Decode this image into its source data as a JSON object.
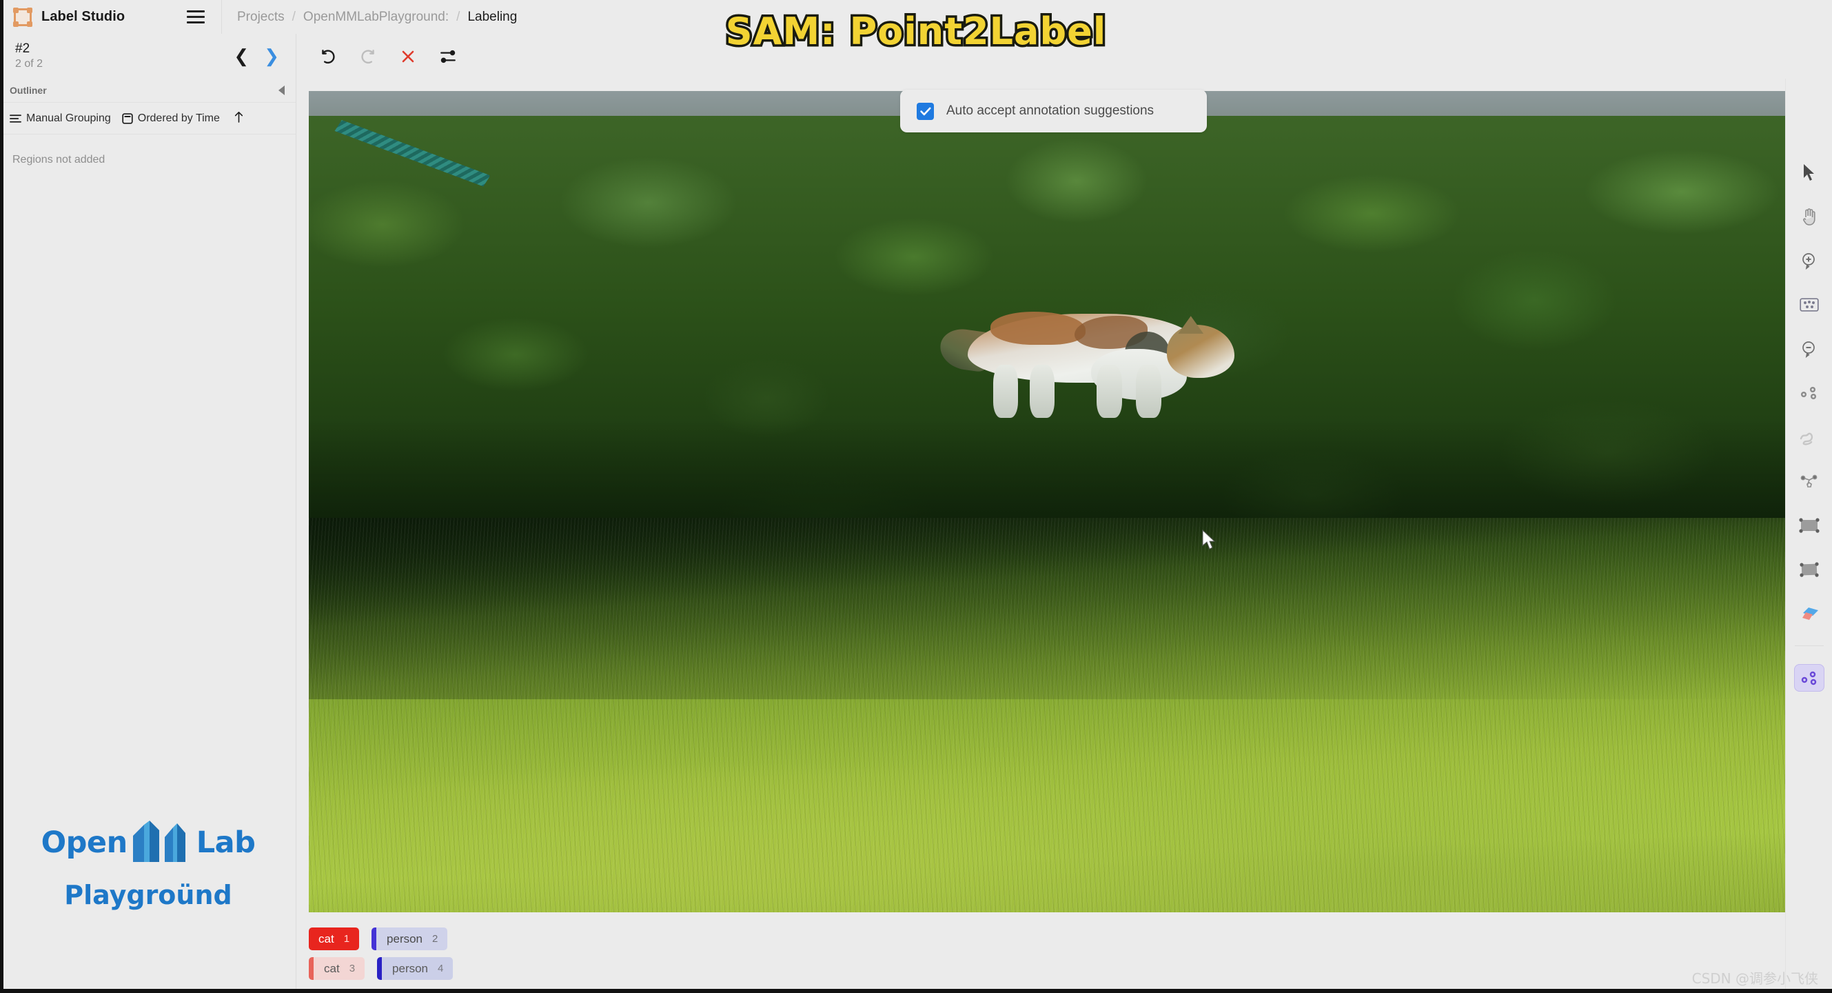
{
  "app": {
    "brand_name": "Label Studio",
    "logo_icon": "label-studio-frame-icon",
    "menu_icon": "hamburger-menu-icon"
  },
  "banner": {
    "title": "SAM: Point2Label"
  },
  "breadcrumb": {
    "items": [
      {
        "label": "Projects",
        "current": false
      },
      {
        "label": "OpenMMLabPlayground:",
        "current": false
      },
      {
        "label": "Labeling",
        "current": true
      }
    ],
    "separator": "/"
  },
  "task": {
    "id": "#2",
    "position": "2 of 2",
    "prev_icon": "chevron-left-icon",
    "next_icon": "chevron-right-icon"
  },
  "toolbar": {
    "buttons": [
      {
        "name": "undo-button",
        "icon": "undo-icon",
        "label": "Undo",
        "enabled": true
      },
      {
        "name": "redo-button",
        "icon": "redo-icon",
        "label": "Redo",
        "enabled": false
      },
      {
        "name": "delete-button",
        "icon": "close-x-icon",
        "label": "Delete all regions",
        "enabled": true
      },
      {
        "name": "settings-button",
        "icon": "sliders-icon",
        "label": "Settings",
        "enabled": true
      }
    ]
  },
  "outliner": {
    "title": "Outliner",
    "collapse_icon": "collapse-left-icon",
    "grouping_label": "Manual Grouping",
    "grouping_icon": "grouping-lines-icon",
    "ordering_label": "Ordered by Time",
    "ordering_icon": "ordering-box-icon",
    "sort_icon": "arrow-up-icon",
    "empty_message": "Regions not added"
  },
  "sidebar_logo": {
    "brand": "OpenMMLab",
    "brand_prefix": "Open",
    "brand_suffix": "Lab",
    "sub": "Playgroünd",
    "color": "#1e78c8"
  },
  "auto_accept": {
    "label": "Auto accept annotation suggestions",
    "checked": true,
    "check_icon": "checkmark-icon",
    "accent": "#1f7ae0"
  },
  "canvas": {
    "image_alt": "Calico cat walking on grass in front of a green hedge",
    "cursor_icon": "mouse-pointer-icon"
  },
  "tools_panel": {
    "items": [
      {
        "name": "cursor-tool",
        "icon": "mouse-pointer-icon",
        "label": "Move",
        "active": false
      },
      {
        "name": "pan-tool",
        "icon": "hand-icon",
        "label": "Pan",
        "active": false
      },
      {
        "name": "zoom-in-tool",
        "icon": "zoom-in-icon",
        "label": "Zoom in",
        "active": false
      },
      {
        "name": "fit-tool",
        "icon": "fit-to-screen-icon",
        "label": "Fit to screen",
        "active": false
      },
      {
        "name": "zoom-out-tool",
        "icon": "zoom-out-icon",
        "label": "Zoom out",
        "active": false
      },
      {
        "name": "keypoint-tool",
        "icon": "keypoints-icon",
        "label": "Keypoints",
        "active": false
      },
      {
        "name": "brush-tool",
        "icon": "brush-icon",
        "label": "Brush",
        "active": false
      },
      {
        "name": "polygon-tool",
        "icon": "polygon-icon",
        "label": "Polygon",
        "active": false
      },
      {
        "name": "rectangle-tool",
        "icon": "rectangle-icon",
        "label": "Rectangle",
        "active": false
      },
      {
        "name": "rectangle3-tool",
        "icon": "rectangle-rotate-icon",
        "label": "Rotatable rectangle",
        "active": false
      },
      {
        "name": "eraser-tool",
        "icon": "eraser-icon",
        "label": "Eraser",
        "active": false
      },
      {
        "name": "magic-keypoints-tool",
        "icon": "magic-keypoints-icon",
        "label": "Smart keypoints",
        "active": true
      }
    ]
  },
  "labels": {
    "rows": [
      [
        {
          "name": "label-cat-1",
          "text": "cat",
          "hotkey": "1",
          "style": "solid-red",
          "selected": true
        },
        {
          "name": "label-person-2",
          "text": "person",
          "hotkey": "2",
          "style": "soft-blue",
          "selected": false
        }
      ],
      [
        {
          "name": "label-cat-3",
          "text": "cat",
          "hotkey": "3",
          "style": "soft-red",
          "selected": false
        },
        {
          "name": "label-person-4",
          "text": "person",
          "hotkey": "4",
          "style": "soft-blue2",
          "selected": false
        }
      ]
    ]
  },
  "watermark": {
    "text": "CSDN @调参小飞侠"
  }
}
